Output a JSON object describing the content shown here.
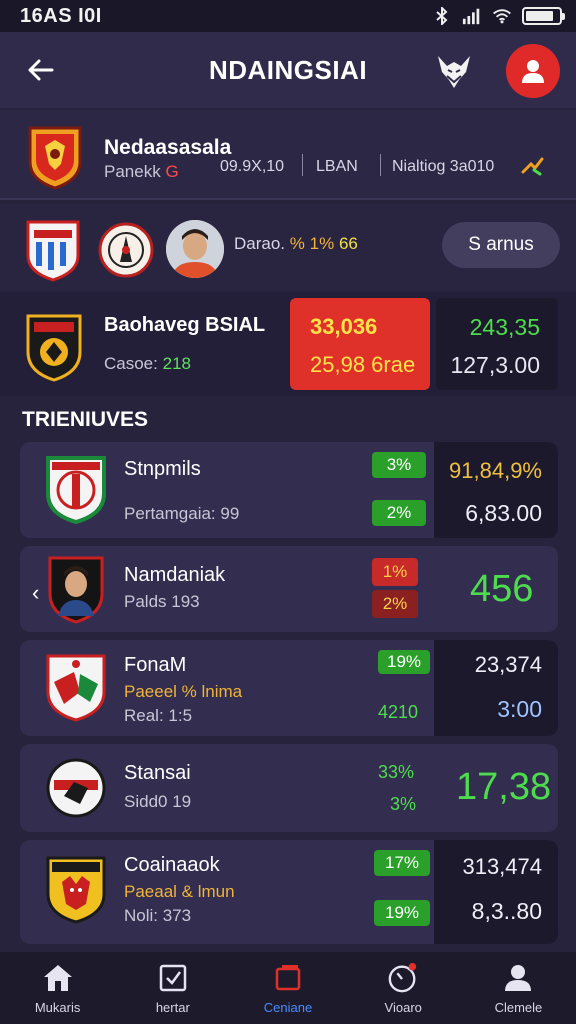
{
  "status_bar": {
    "time": "16AS I0I",
    "icons": [
      "bluetooth-icon",
      "signal-icon",
      "wifi-icon",
      "battery-icon"
    ],
    "battery_level": 0.85
  },
  "header": {
    "title": "NDAINGSIAI"
  },
  "team_card": {
    "name": "Nedaasasala",
    "sub_label": "Panekk",
    "sub_value": "G",
    "stat_1": "09.9X,10",
    "stat_2": "LBAN",
    "stat_3": "Nialtiog 3a010"
  },
  "lineup": {
    "text_prefix": "Darao.",
    "text_amber": "%",
    "text_pct": "1%",
    "text_num": "66",
    "button_label": "S arnus"
  },
  "featured": {
    "name": "Baohaveg BSIAL",
    "sub_label": "Casoe:",
    "sub_value": "218",
    "odds_red_1": "33,036",
    "odds_red_2": "25,98 6rae",
    "odds_1": "243,35",
    "odds_2": "127,3.00"
  },
  "section_title": "TRIENIUVES",
  "items": [
    {
      "name": "Stnpmils",
      "sub": "Pertamgaia: 99",
      "pct_1": "3%",
      "pct_2": "2%",
      "odds_1": "91,84,9%",
      "odds_2": "6,83.00"
    },
    {
      "name": "Namdaniak",
      "sub": "Palds 193",
      "pct_1": "1%",
      "pct_2": "2%",
      "big": "456"
    },
    {
      "name": "FonaM",
      "sub": "Paeeel % lnima",
      "sub2": "Real: 1:5",
      "pct_1": "19%",
      "pct_text": "4210",
      "odds_1": "23,374",
      "odds_2": "3:00"
    },
    {
      "name": "Stansai",
      "sub": "Sidd0 19",
      "pct_1": "33%",
      "pct_2": "3%",
      "big": "17,38"
    },
    {
      "name": "Coainaaok",
      "sub": "Paeaal & lmun",
      "sub2": "Noli: 373",
      "pct_1": "17%",
      "pct_2": "19%",
      "odds_1": "313,474",
      "odds_2": "8,3..80"
    }
  ],
  "nav": [
    {
      "label": "Mukaris",
      "icon": "home-icon"
    },
    {
      "label": "hertar",
      "icon": "bet-slip-icon"
    },
    {
      "label": "Ceniane",
      "icon": "live-icon"
    },
    {
      "label": "Vioaro",
      "icon": "clock-icon"
    },
    {
      "label": "Clemele",
      "icon": "profile-icon"
    }
  ],
  "colors": {
    "background": "#27233d",
    "accent_red": "#e0302a",
    "accent_green": "#4ddc4d",
    "accent_blue": "#4a8cff"
  }
}
